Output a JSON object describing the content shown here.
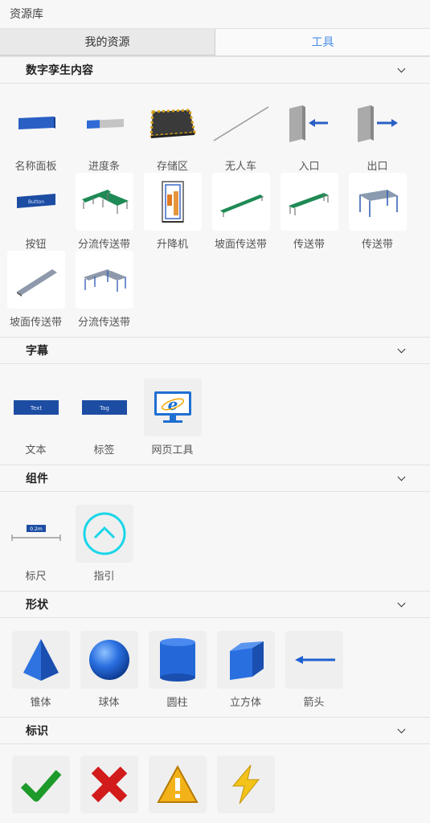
{
  "title": "资源库",
  "tabs": [
    {
      "label": "我的资源"
    },
    {
      "label": "工具"
    }
  ],
  "sections": {
    "digital": {
      "title": "数字孪生内容",
      "items": [
        {
          "label": "名称面板"
        },
        {
          "label": "进度条"
        },
        {
          "label": "存储区"
        },
        {
          "label": "无人车"
        },
        {
          "label": "入口"
        },
        {
          "label": "出口"
        },
        {
          "label": "按钮",
          "button_text": "Button"
        },
        {
          "label": "分流传送带"
        },
        {
          "label": "升降机"
        },
        {
          "label": "坡面传送带"
        },
        {
          "label": "传送带"
        },
        {
          "label": "传送带"
        },
        {
          "label": "坡面传送带"
        },
        {
          "label": "分流传送带"
        }
      ]
    },
    "subtitle": {
      "title": "字幕",
      "items": [
        {
          "label": "文本",
          "inner": "Text"
        },
        {
          "label": "标签",
          "inner": "Tag"
        },
        {
          "label": "网页工具"
        }
      ]
    },
    "component": {
      "title": "组件",
      "items": [
        {
          "label": "标尺",
          "inner": "0.2m"
        },
        {
          "label": "指引"
        }
      ]
    },
    "shape": {
      "title": "形状",
      "items": [
        {
          "label": "锥体"
        },
        {
          "label": "球体"
        },
        {
          "label": "圆柱"
        },
        {
          "label": "立方体"
        },
        {
          "label": "箭头"
        }
      ]
    },
    "marker": {
      "title": "标识",
      "items": [
        {
          "icon": "check-icon"
        },
        {
          "icon": "cross-icon"
        },
        {
          "icon": "warning-icon"
        },
        {
          "icon": "lightning-icon"
        }
      ]
    }
  },
  "colors": {
    "accent": "#4a8fe7",
    "blue3d": "#2367d1"
  }
}
